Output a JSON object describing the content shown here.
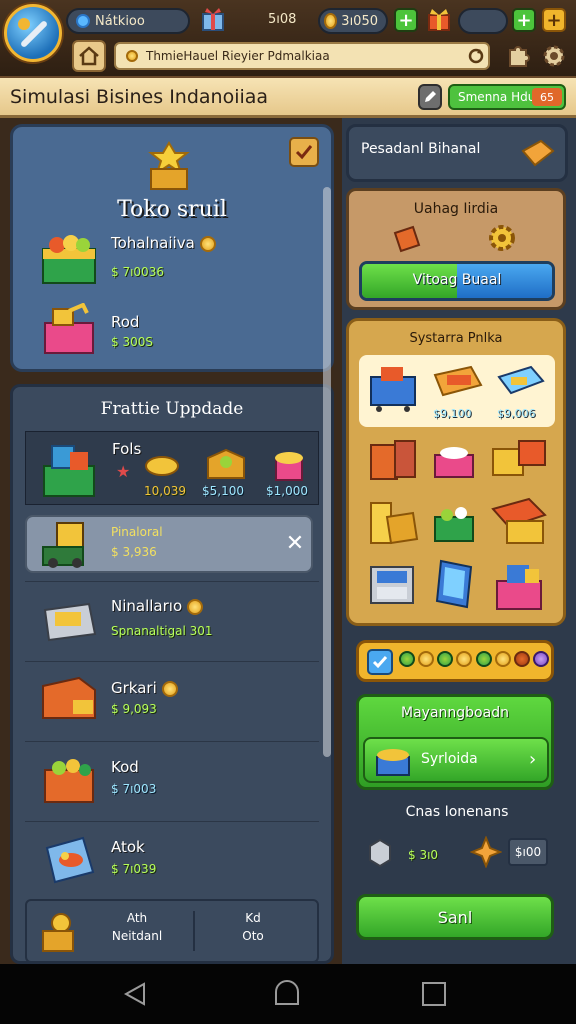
{
  "topbar": {
    "player_name": "Nátkioo",
    "gems": "5ı08",
    "coins": "3ı050",
    "url": "ThmieHauel Rieyier Pdmalkiaa"
  },
  "titlebar": {
    "title": "Simulasi Bisines Indanoiiaa",
    "badge_label": "Smenna Hdu",
    "badge_count": "65"
  },
  "left": {
    "store": {
      "title": "Toko sruil",
      "items": [
        {
          "name": "Tohalnaiiva",
          "price": "$ 7ı0036"
        },
        {
          "name": "Rod",
          "price": "$ 300S"
        }
      ]
    },
    "upgrade": {
      "title": "Frattie Uppdade",
      "featured": {
        "name": "Fols",
        "prices": [
          "10,039",
          "$5,100",
          "$1,000"
        ]
      },
      "selected": {
        "name": "Pinaloral",
        "price": "$ 3,936"
      },
      "items": [
        {
          "name": "Ninallarıo",
          "price": "Spnanaltigal 301"
        },
        {
          "name": "Grkari",
          "price": "$ 9,093"
        },
        {
          "name": "Kod",
          "price": "$ 7ı003"
        },
        {
          "name": "Atok",
          "price": "$ 7ı039"
        }
      ],
      "footer": [
        {
          "line1": "Ath",
          "line2": "Neitdanl"
        },
        {
          "line1": "Kd",
          "line2": "Oto"
        }
      ]
    }
  },
  "right": {
    "header": "Pesadanl Bihanal",
    "daily": {
      "title": "Uahag Iirdia",
      "button": "Vitoag Buaal"
    },
    "catalog": {
      "title": "Systarra Pnlka",
      "featured_prices": [
        "$9,100",
        "$9,006"
      ]
    },
    "manager": {
      "title": "Mayanngboadn",
      "button": "Syrloida"
    },
    "costs": {
      "title": "Cnas Ionenans",
      "price1": "$ 3ı0",
      "price2": "$ı00"
    },
    "save_button": "Sanl"
  },
  "colors": {
    "panel_blue": "#4a6a92",
    "panel_dark": "#3b4a5e",
    "gold": "#d6a74e",
    "green": "#4cc43b"
  }
}
